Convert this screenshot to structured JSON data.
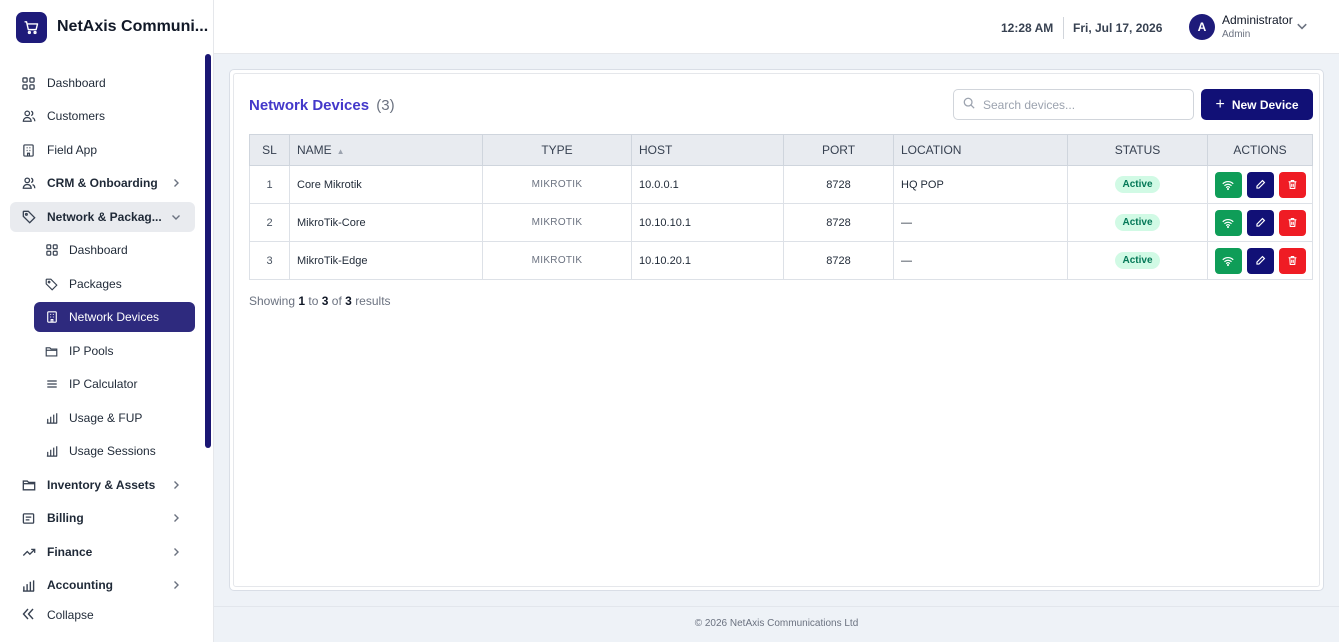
{
  "brand": {
    "name": "NetAxis Communi..."
  },
  "header": {
    "time": "12:28 AM",
    "date": "Fri, Jul 17, 2026",
    "user_initial": "A",
    "user_name": "Administrator",
    "user_role": "Admin"
  },
  "sidebar": {
    "items": [
      {
        "label": "Dashboard",
        "icon": "grid-icon"
      },
      {
        "label": "Customers",
        "icon": "users-icon"
      },
      {
        "label": "Field App",
        "icon": "building-icon"
      },
      {
        "label": "CRM & Onboarding",
        "icon": "users-icon"
      },
      {
        "label": "Network & Packag...",
        "icon": "tag-icon"
      },
      {
        "label": "Dashboard",
        "icon": "grid-icon"
      },
      {
        "label": "Packages",
        "icon": "tag-icon"
      },
      {
        "label": "Network Devices",
        "icon": "building-icon"
      },
      {
        "label": "IP Pools",
        "icon": "folder-icon"
      },
      {
        "label": "IP Calculator",
        "icon": "list-icon"
      },
      {
        "label": "Usage & FUP",
        "icon": "bar-chart-icon"
      },
      {
        "label": "Usage Sessions",
        "icon": "bar-chart-icon"
      },
      {
        "label": "Inventory & Assets",
        "icon": "folder-icon"
      },
      {
        "label": "Billing",
        "icon": "billing-icon"
      },
      {
        "label": "Finance",
        "icon": "trend-icon"
      },
      {
        "label": "Accounting",
        "icon": "bar-chart-icon"
      }
    ],
    "collapse_label": "Collapse"
  },
  "main": {
    "title": "Network Devices",
    "count": "(3)",
    "search_placeholder": "Search devices...",
    "new_button": "New Device",
    "columns": [
      "SL",
      "NAME",
      "TYPE",
      "HOST",
      "PORT",
      "LOCATION",
      "STATUS",
      "ACTIONS"
    ],
    "rows": [
      {
        "sl": "1",
        "name": "Core Mikrotik",
        "type": "MIKROTIK",
        "host": "10.0.0.1",
        "port": "8728",
        "location": "HQ POP",
        "status": "Active"
      },
      {
        "sl": "2",
        "name": "MikroTik-Core",
        "type": "MIKROTIK",
        "host": "10.10.10.1",
        "port": "8728",
        "location": "—",
        "status": "Active"
      },
      {
        "sl": "3",
        "name": "MikroTik-Edge",
        "type": "MIKROTIK",
        "host": "10.10.20.1",
        "port": "8728",
        "location": "—",
        "status": "Active"
      }
    ],
    "showing": {
      "prefix": "Showing",
      "from": "1",
      "to_word": "to",
      "to": "3",
      "of_word": "of",
      "total": "3",
      "suffix": "results"
    }
  },
  "footer": {
    "text": "© 2026 NetAxis Communications Ltd"
  },
  "colors": {
    "brand": "#1e1b7a",
    "active_nav": "#2e2a7e",
    "title": "#4338ca",
    "success": "#0f9d58",
    "danger": "#ef1c24"
  }
}
